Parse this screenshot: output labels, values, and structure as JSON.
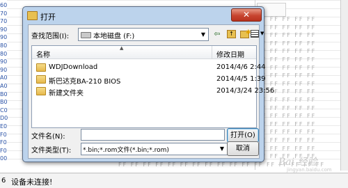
{
  "background": {
    "row_labels": [
      "60",
      "70",
      "70",
      "90",
      "90",
      "80",
      "80",
      "90",
      "90",
      "A0",
      "A0",
      "B0",
      "B0",
      "C0",
      "D0",
      "E0",
      "F0",
      "F0",
      "F0",
      "00"
    ],
    "right_columns": [
      "FF FF FF FF FF",
      "FF FF FF FF FF",
      "FF FF FF FF FF",
      "FF FF FF FF FF",
      "FF FF FF FF FF",
      "FF FF FF FF FF",
      "FF FF FF FF FF",
      "FF FF FF FF FF",
      "FF FF FF FF FF",
      "FF FF FF FF FF",
      "FF FF FF FF FF",
      "FF FF FF FF FF",
      "FF FF FF FF FF",
      "FF FF FF FF FF",
      "FF FF FF FF FF",
      "FF FF FF FF FF",
      "FF FF FF FF FF",
      "FF FF FF FF FF"
    ],
    "bottom_columns": "FF FF FF FF FF FF FF FF FF FF FF FF FF FF FF FF FF"
  },
  "status": {
    "number": "6",
    "text": "设备未连接!"
  },
  "watermark": {
    "text": "Bai 经验",
    "sub": "jingyan.baidu.com"
  },
  "dialog": {
    "title": "打开",
    "close_glyph": "✕",
    "look_in_label": "查找范围(I):",
    "look_in_value": "本地磁盘 (F:)",
    "toolbar": {
      "back": "⇦",
      "up": "↑"
    },
    "columns": {
      "name": "名称",
      "date": "修改日期"
    },
    "files": [
      {
        "name": "WDJDownload",
        "date": "2014/4/6 2:44"
      },
      {
        "name": "斯巴达克BA-210 BIOS",
        "date": "2014/4/5 1:39"
      },
      {
        "name": "新建文件夹",
        "date": "2014/3/24 23:56"
      }
    ],
    "filename_label": "文件名(N):",
    "filename_value": "",
    "filetype_label": "文件类型(T):",
    "filetype_value": "*.bin;*.rom文件(*.bin;*.rom)",
    "open_label": "打开(O)",
    "cancel_label": "取消"
  }
}
